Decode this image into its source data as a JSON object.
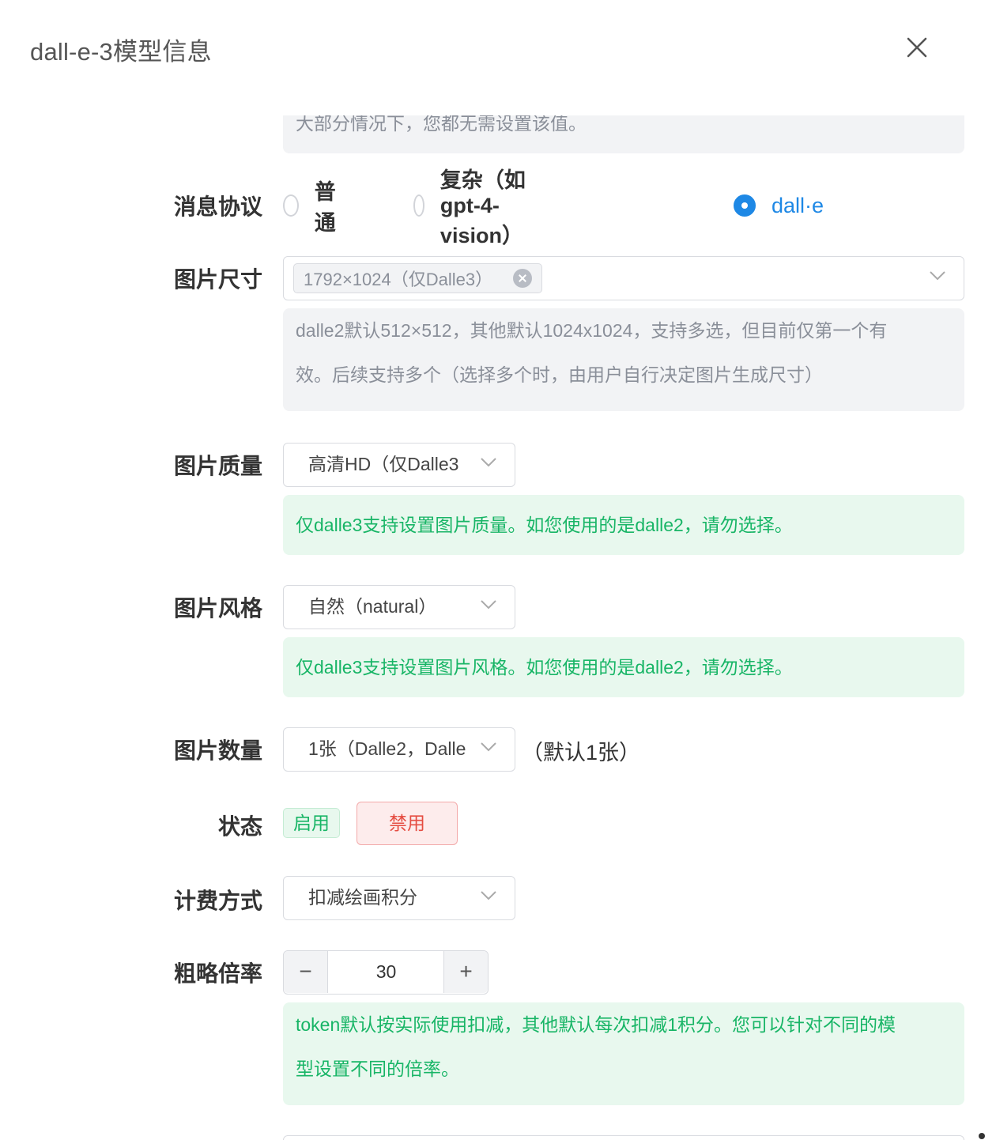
{
  "modal": {
    "title": "dall-e-3模型信息"
  },
  "top_tip": "大部分情况下，您都无需设置该值。",
  "protocol": {
    "label": "消息协议",
    "options": [
      "普通",
      "复杂（如gpt-4-vision）",
      "dall·e"
    ],
    "selected": "dall·e"
  },
  "image_size": {
    "label": "图片尺寸",
    "tags": [
      "1792×1024（仅Dalle3）"
    ],
    "tip_line1": "dalle2默认512×512，其他默认1024x1024，支持多选，但目前仅第一个有",
    "tip_line2": "效。后续支持多个（选择多个时，由用户自行决定图片生成尺寸）"
  },
  "image_quality": {
    "label": "图片质量",
    "value": "高清HD（仅Dalle3",
    "tip": "仅dalle3支持设置图片质量。如您使用的是dalle2，请勿选择。"
  },
  "image_style": {
    "label": "图片风格",
    "value": "自然（natural）",
    "tip": "仅dalle3支持设置图片风格。如您使用的是dalle2，请勿选择。"
  },
  "image_count": {
    "label": "图片数量",
    "value": "1张（Dalle2，Dalle",
    "hint": "（默认1张）"
  },
  "status": {
    "label": "状态",
    "enabled_label": "启用",
    "disabled_label": "禁用"
  },
  "billing": {
    "label": "计费方式",
    "value": "扣减绘画积分"
  },
  "rate": {
    "label": "粗略倍率",
    "value": "30",
    "minus": "−",
    "plus": "+",
    "tip_line1": "token默认按实际使用扣减，其他默认每次扣减1积分。您可以针对不同的模",
    "tip_line2": "型设置不同的倍率。"
  },
  "colors": {
    "accent": "#1e88e5",
    "success": "#18b566",
    "danger": "#e54d42"
  }
}
